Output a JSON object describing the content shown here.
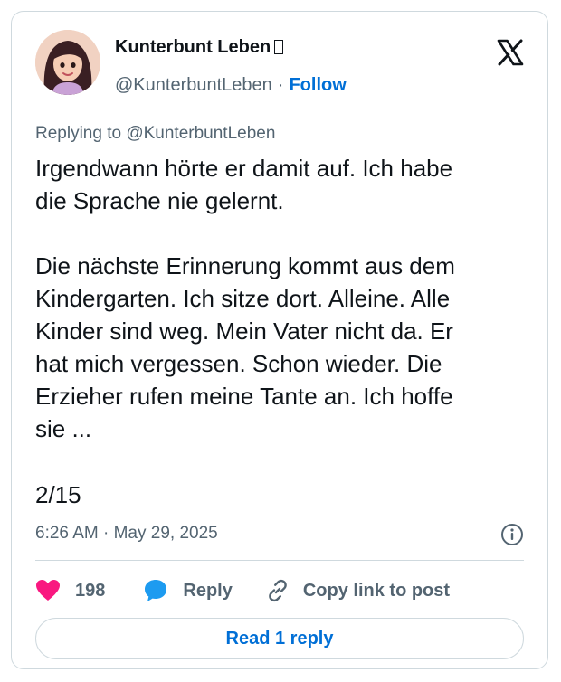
{
  "author": {
    "display_name": "Kunterbunt Leben",
    "name_emoji_glyph": "▯",
    "handle": "@KunterbuntLeben",
    "separator": "·",
    "follow_label": "Follow"
  },
  "replying_to": "Replying to @KunterbuntLeben",
  "tweet": {
    "text": "Irgendwann hörte er damit auf. Ich habe\ndie Sprache nie gelernt.\n\nDie nächste Erinnerung kommt aus dem\nKindergarten. Ich sitze dort. Alleine. Alle\nKinder sind weg. Mein Vater nicht da. Er\nhat mich vergessen. Schon wieder. Die\nErzieher rufen meine Tante an. Ich hoffe\nsie ...",
    "thread_count": "2/15",
    "time": "6:26 AM",
    "meta_separator": "·",
    "date": "May 29, 2025"
  },
  "actions": {
    "like_count": "198",
    "reply_label": "Reply",
    "copy_link_label": "Copy link to post"
  },
  "read_reply_label": "Read 1 reply",
  "colors": {
    "link_blue": "#006fd6",
    "heart_pink": "#f91880",
    "reply_bubble_blue": "#1d9bf0",
    "muted_text": "#536471",
    "border": "#cfd9de"
  },
  "icons": [
    "avatar-illustration",
    "x-logo-icon",
    "info-icon",
    "heart-icon",
    "reply-bubble-icon",
    "link-icon"
  ]
}
